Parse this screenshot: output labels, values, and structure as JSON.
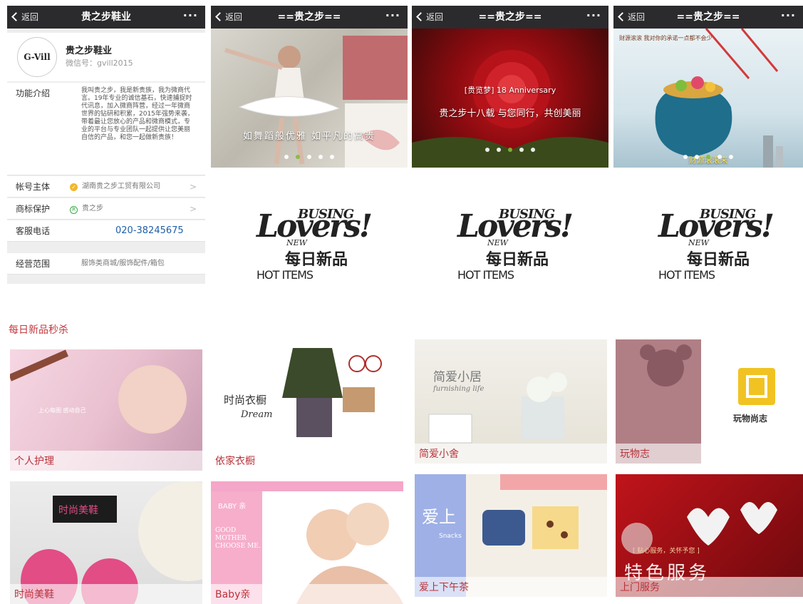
{
  "profile_screen": {
    "nav": {
      "back_label": "返回",
      "title": "贵之步鞋业",
      "more": "···"
    },
    "logo_text": "G-Vill",
    "name": "贵之步鞋业",
    "wechat_id": "微信号：gvill2015",
    "intro": {
      "label": "功能介绍",
      "text": "我叫贵之步，我是新贵族，我为微商代言。19年专业的诚信基石，快速捕捉时代讯息，加入微商阵营，经过一年微商世界的钻研和积累，2015年强势来袭，带着最让您放心的产品和微商模式，专业的平台与专业团队一起提供让您美丽自信的产品，和您一起做新贵族！"
    },
    "rows": [
      {
        "label": "帐号主体",
        "value": "湖南贵之步工贸有限公司",
        "arrow": ">"
      },
      {
        "label": "商标保护",
        "value": "贵之步",
        "arrow": ">"
      },
      {
        "label": "客服电话",
        "phone": "020-38245675"
      },
      {
        "label": "经营范围",
        "value": "服饰类商城/服饰配件/箱包"
      }
    ]
  },
  "screens": [
    {
      "back_label": "返回",
      "title": "==贵之步==",
      "more": "···",
      "caption": "如舞蹈般优雅 如平凡的高贵"
    },
    {
      "back_label": "返回",
      "title": "==贵之步==",
      "more": "···",
      "caption": "贵之步十八载 与您同行，共创美丽",
      "sub": "[贵览梦] 18 Anniversary"
    },
    {
      "back_label": "返回",
      "title": "==贵之步==",
      "more": "···",
      "caption": "财源滚滚来",
      "sub": "财源滚滚 我对你的承诺一点都不会少"
    }
  ],
  "hot_logo": {
    "busing": "BUSING",
    "lovers": "Lovers!",
    "new": "NEW",
    "daily": "每日新品",
    "hot": "HOT ITEMS"
  },
  "section_title": "每日新品秒杀",
  "tiles": [
    {
      "caption": "个人护理",
      "art": "上心每图 感动自己"
    },
    {
      "caption": "依家衣橱",
      "art": "时尚衣橱",
      "art2": "Dream"
    },
    {
      "caption": "简爱小舍",
      "art": "简爱小居",
      "art2": "furnishing life"
    },
    {
      "caption": "玩物志",
      "art": "玩物尚志"
    },
    {
      "caption": "时尚美鞋",
      "art": "时尚美鞋"
    },
    {
      "caption": "Baby亲",
      "art": "BABY 亲",
      "art2": "GOOD MOTHER CHOOSE ME."
    },
    {
      "caption": "爱上下午茶",
      "art": "爱上",
      "art2": "Snacks"
    },
    {
      "caption": "上门服务",
      "art": "特色服务",
      "art2": "[ 贴心服务，关怀予您 ]"
    }
  ],
  "colors": {
    "navbar": "#2b2b2d",
    "accent_red": "#c4383f",
    "link_blue": "#1f5fa8",
    "dot_active": "#7fbd3c"
  }
}
